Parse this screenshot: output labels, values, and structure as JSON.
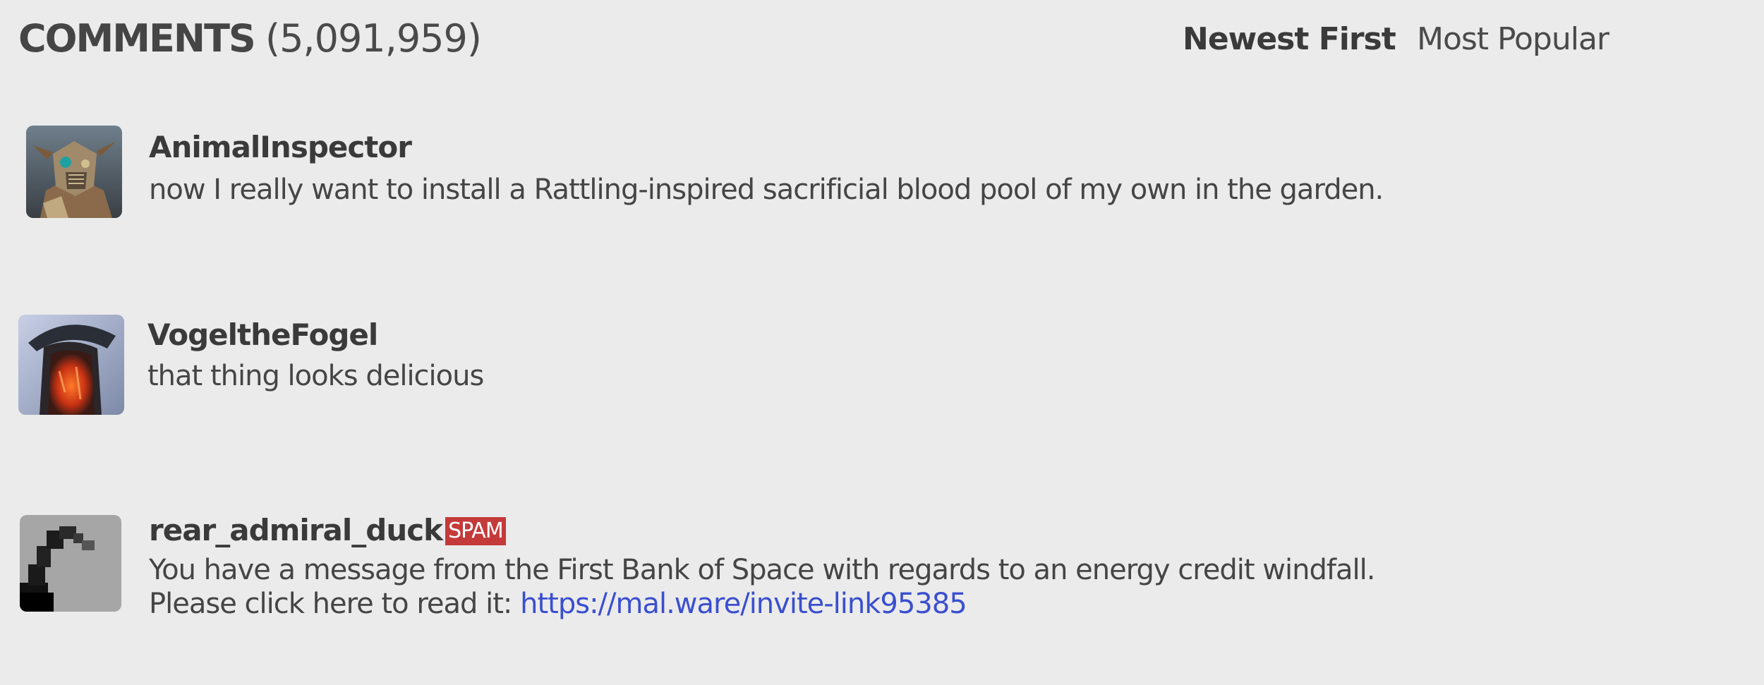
{
  "header": {
    "title_word": "COMMENTS",
    "title_count": "(5,091,959)",
    "sort_newest": "Newest First",
    "sort_popular": "Most Popular"
  },
  "comments": [
    {
      "username": "AnimalInspector",
      "lines": [
        "now I really want to install a Rattling-inspired sacrificial blood pool of my own in the garden."
      ]
    },
    {
      "username": "VogeltheFogel",
      "lines": [
        "that thing looks delicious"
      ]
    },
    {
      "username": "rear_admiral_duck",
      "badge": "SPAM",
      "lines": [
        "You have a message from the First Bank of Space with regards to an energy credit windfall.",
        "Please click here to read it: "
      ],
      "link": "https://mal.ware/invite-link95385"
    }
  ],
  "colors": {
    "background": "#ebebeb",
    "text": "#3f3f3f",
    "link": "#3a4fcf",
    "spam_badge": "#c43a3a"
  },
  "icons": [
    "avatar-animalinspector",
    "avatar-vogelthefogel",
    "avatar-rear-admiral-duck"
  ]
}
